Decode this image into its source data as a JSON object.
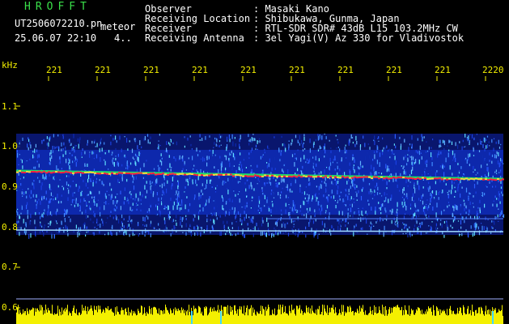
{
  "header": {
    "brand": "HROFFT",
    "filename": "UT2506072210.pn",
    "tag": "meteor",
    "datetime": "25.06.07 22:10",
    "count": "4..",
    "info_labels": [
      "Observer",
      "Receiving Location",
      "Receiver",
      "Receiving Antenna"
    ],
    "info_values": [
      ": Masaki Kano",
      ": Shibukawa, Gunma, Japan",
      ": RTL-SDR SDR# 43dB L15 103.2MHz CW",
      ": 3el Yagi(V) Az 330 for Vladivostok"
    ]
  },
  "axes": {
    "y_unit": "kHz",
    "y_ticks": [
      "1.1",
      "1.0",
      "0.9",
      "0.8",
      "0.7",
      "0.6"
    ],
    "x_ticks": [
      "221",
      "221",
      "221",
      "221",
      "221",
      "221",
      "221",
      "221",
      "221",
      "2220"
    ]
  },
  "colors": {
    "background": "#000000",
    "labels": "#f4f000",
    "header_text": "#ffffff",
    "brand": "#3ae04a",
    "signal": "#ff2040",
    "noise_band": "#1030c8"
  }
}
